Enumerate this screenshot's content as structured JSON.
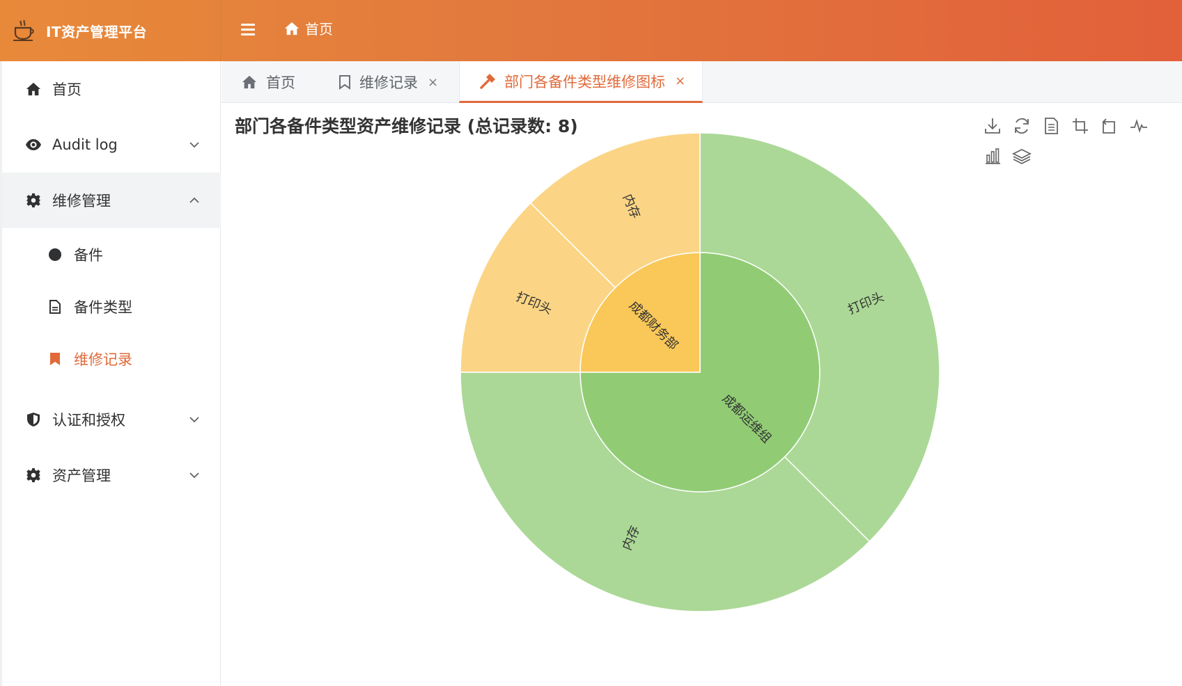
{
  "header": {
    "app_title": "IT资产管理平台",
    "breadcrumb": "首页"
  },
  "sidebar": {
    "items": [
      {
        "label": "首页",
        "icon": "home-icon"
      },
      {
        "label": "Audit log",
        "icon": "eye-icon"
      },
      {
        "label": "维修管理",
        "icon": "gear-icon",
        "open": true,
        "children": [
          {
            "label": "备件",
            "icon": "circle-icon"
          },
          {
            "label": "备件类型",
            "icon": "document-icon"
          },
          {
            "label": "维修记录",
            "icon": "bookmark-icon",
            "active": true
          }
        ]
      },
      {
        "label": "认证和授权",
        "icon": "shield-icon"
      },
      {
        "label": "资产管理",
        "icon": "gear-icon"
      }
    ]
  },
  "tabs": [
    {
      "label": "首页",
      "icon": "home-icon",
      "closable": false
    },
    {
      "label": "维修记录",
      "icon": "bookmark-icon",
      "closable": true
    },
    {
      "label": "部门各备件类型维修图标",
      "icon": "hammer-icon",
      "closable": true,
      "active": true
    }
  ],
  "close_glyph": "×",
  "main": {
    "title": "部门各备件类型资产维修记录 (总记录数: 8)"
  },
  "toolbox": [
    "download-icon",
    "refresh-icon",
    "data-view-icon",
    "zoom-icon",
    "zoom-reset-icon",
    "line-chart-icon",
    "bar-chart-icon",
    "stack-icon"
  ],
  "colors": {
    "accent": "#e06a3a",
    "header_start": "#e88a3a",
    "header_end": "#e2603a",
    "green_inner": "#91cc75",
    "green_outer": "#abd896",
    "yellow_inner": "#fac858",
    "yellow_outer": "#fbd585"
  },
  "chart_data": {
    "type": "sunburst",
    "title": "部门各备件类型资产维修记录 (总记录数: 8)",
    "total": 8,
    "series": [
      {
        "name": "成都运维组",
        "value": 6,
        "color": "#91cc75",
        "children": [
          {
            "name": "打印头",
            "value": 3,
            "color": "#abd896"
          },
          {
            "name": "内存",
            "value": 3,
            "color": "#abd896"
          }
        ]
      },
      {
        "name": "成都财务部",
        "value": 2,
        "color": "#fac858",
        "children": [
          {
            "name": "打印头",
            "value": 1,
            "color": "#fbd585"
          },
          {
            "name": "内存",
            "value": 1,
            "color": "#fbd585"
          }
        ]
      }
    ]
  }
}
